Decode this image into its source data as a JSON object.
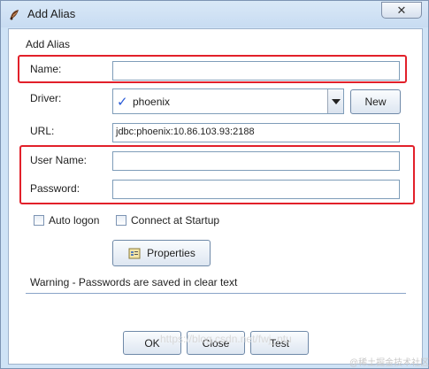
{
  "window": {
    "title": "Add Alias",
    "close_symbol": "✕"
  },
  "group_title": "Add Alias",
  "name": {
    "label": "Name:",
    "value": ""
  },
  "driver": {
    "label": "Driver:",
    "selected": "phoenix",
    "new_label": "New"
  },
  "url": {
    "label": "URL:",
    "value": "jdbc:phoenix:10.86.103.93:2188"
  },
  "user_name": {
    "label": "User Name:",
    "value": ""
  },
  "password": {
    "label": "Password:",
    "value": ""
  },
  "options": {
    "auto_logon": "Auto logon",
    "connect_at_startup": "Connect at Startup"
  },
  "properties_label": "Properties",
  "warning": "Warning - Passwords are saved in clear text",
  "buttons": {
    "ok": "OK",
    "close": "Close",
    "test": "Test"
  },
  "watermark": {
    "url": "https://blog.csdn.net/fwj_ntu",
    "brand": "@稀土掘金技术社区"
  },
  "colors": {
    "highlight": "#e2202a",
    "check": "#2a5bd7"
  }
}
